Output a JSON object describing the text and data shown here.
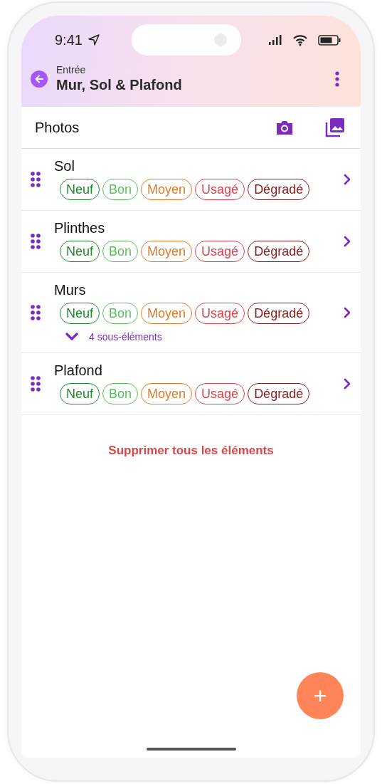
{
  "status_bar": {
    "time": "9:41"
  },
  "header": {
    "subtitle": "Entrée",
    "title": "Mur, Sol & Plafond"
  },
  "photos": {
    "label": "Photos"
  },
  "items": [
    {
      "name": "Sol",
      "chips": [
        {
          "label": "Neuf",
          "color": "#1f8a30"
        },
        {
          "label": "Bon",
          "color": "#5cbf5c"
        },
        {
          "label": "Moyen",
          "color": "#e07b2a"
        },
        {
          "label": "Usagé",
          "color": "#d9434f"
        },
        {
          "label": "Dégradé",
          "color": "#861c1c"
        }
      ]
    },
    {
      "name": "Plinthes",
      "chips": [
        {
          "label": "Neuf",
          "color": "#1f8a30"
        },
        {
          "label": "Bon",
          "color": "#5cbf5c"
        },
        {
          "label": "Moyen",
          "color": "#e07b2a"
        },
        {
          "label": "Usagé",
          "color": "#d9434f"
        },
        {
          "label": "Dégradé",
          "color": "#861c1c"
        }
      ]
    },
    {
      "name": "Murs",
      "chips": [
        {
          "label": "Neuf",
          "color": "#1f8a30"
        },
        {
          "label": "Bon",
          "color": "#5cbf5c"
        },
        {
          "label": "Moyen",
          "color": "#e07b2a"
        },
        {
          "label": "Usagé",
          "color": "#d9434f"
        },
        {
          "label": "Dégradé",
          "color": "#861c1c"
        }
      ],
      "subitems": {
        "label": "4 sous-éléments",
        "expanded": false
      }
    },
    {
      "name": "Plafond",
      "chips": [
        {
          "label": "Neuf",
          "color": "#1f8a30"
        },
        {
          "label": "Bon",
          "color": "#5cbf5c"
        },
        {
          "label": "Moyen",
          "color": "#e07b2a"
        },
        {
          "label": "Usagé",
          "color": "#d9434f"
        },
        {
          "label": "Dégradé",
          "color": "#861c1c"
        }
      ]
    }
  ],
  "delete_all": {
    "label": "Supprimer tous les éléments"
  },
  "fab": {
    "label": "+"
  }
}
